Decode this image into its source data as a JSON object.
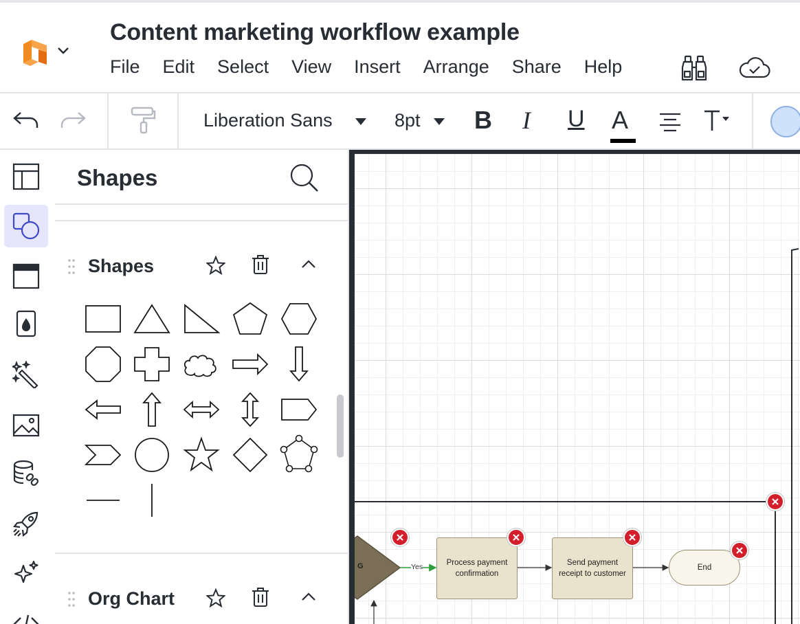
{
  "header": {
    "doc_title": "Content marketing workflow example",
    "menu": [
      "File",
      "Edit",
      "Select",
      "View",
      "Insert",
      "Arrange",
      "Share",
      "Help"
    ],
    "icons": {
      "logo": "lucid-logo-icon",
      "find": "binoculars-icon",
      "sync": "cloud-check-icon"
    }
  },
  "toolbar": {
    "font_family": "Liberation Sans",
    "font_size": "8pt",
    "bold": "B",
    "italic": "I",
    "underline": "U",
    "text_color_label": "A",
    "text_color": "#000000",
    "fill_color": "#cfe2fc"
  },
  "rail": {
    "active": "shapes",
    "items": [
      "pages-icon",
      "shapes-icon",
      "templates-icon",
      "data-fill-icon",
      "magic-icon",
      "image-icon",
      "data-link-icon",
      "rocket-icon",
      "ai-sparkle-icon",
      "code-icon"
    ]
  },
  "panel": {
    "title": "Shapes",
    "sections": [
      {
        "title": "Shapes",
        "expanded": true
      },
      {
        "title": "Org Chart",
        "expanded": true
      }
    ],
    "shapes": [
      "rectangle",
      "triangle",
      "right-triangle",
      "pentagon",
      "hexagon",
      "octagon",
      "cross",
      "cloud",
      "right-arrow",
      "down-arrow",
      "left-arrow",
      "up-arrow",
      "horizontal-double-arrow",
      "vertical-double-arrow",
      "tag",
      "chevron",
      "circle",
      "star",
      "diamond",
      "polygon",
      "horizontal-line",
      "vertical-line"
    ]
  },
  "canvas": {
    "decision_label": "G",
    "yes_label": "Yes",
    "nodes": [
      {
        "text": "Process payment confirmation"
      },
      {
        "text": "Send payment receipt to customer"
      },
      {
        "text": "End"
      }
    ],
    "colors": {
      "process_fill": "#e9e2cc",
      "end_fill": "#f8f5ea",
      "decision_fill": "#7b6e56",
      "error_badge": "#d21f2b",
      "yes_arrow": "#2e9e3a"
    }
  }
}
